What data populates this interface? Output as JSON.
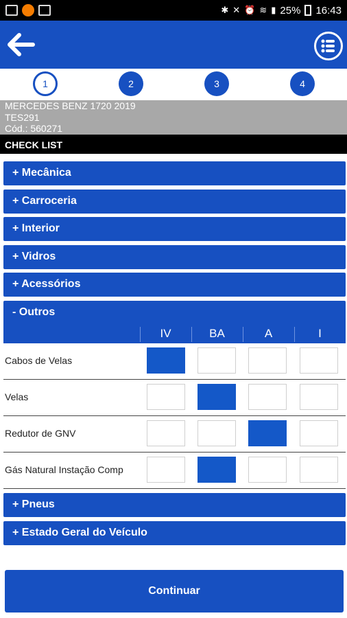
{
  "status": {
    "left_icons": [
      "sim-card-icon",
      "notification-app-icon",
      "image-icon"
    ],
    "battery": "25%",
    "time": "16:43"
  },
  "appbar": {
    "back_icon": "arrow-left-icon",
    "menu_icon": "list-menu-icon"
  },
  "steps": [
    "1",
    "2",
    "3",
    "4"
  ],
  "vehicle": {
    "model": "MERCEDES BENZ 1720 2019",
    "plate": "TES291",
    "code": "Cód.: 560271"
  },
  "section_title": "CHECK LIST",
  "categories_top": [
    "+ Mecânica",
    "+ Carroceria",
    "+ Interior",
    "+ Vidros",
    "+ Acessórios"
  ],
  "outros": {
    "title": "- Outros",
    "columns": [
      "IV",
      "BA",
      "A",
      "I"
    ],
    "rows": [
      {
        "label": "Cabos de Velas",
        "selected": "IV"
      },
      {
        "label": "Velas",
        "selected": "BA"
      },
      {
        "label": "Redutor de GNV",
        "selected": "A"
      },
      {
        "label": "Gás Natural Instação Comp",
        "selected": "BA"
      }
    ]
  },
  "categories_bottom": [
    "+ Pneus",
    "+ Estado Geral do Veículo"
  ],
  "continue_label": "Continuar",
  "colors": {
    "primary": "#1750c1",
    "selected": "#1458c8"
  }
}
